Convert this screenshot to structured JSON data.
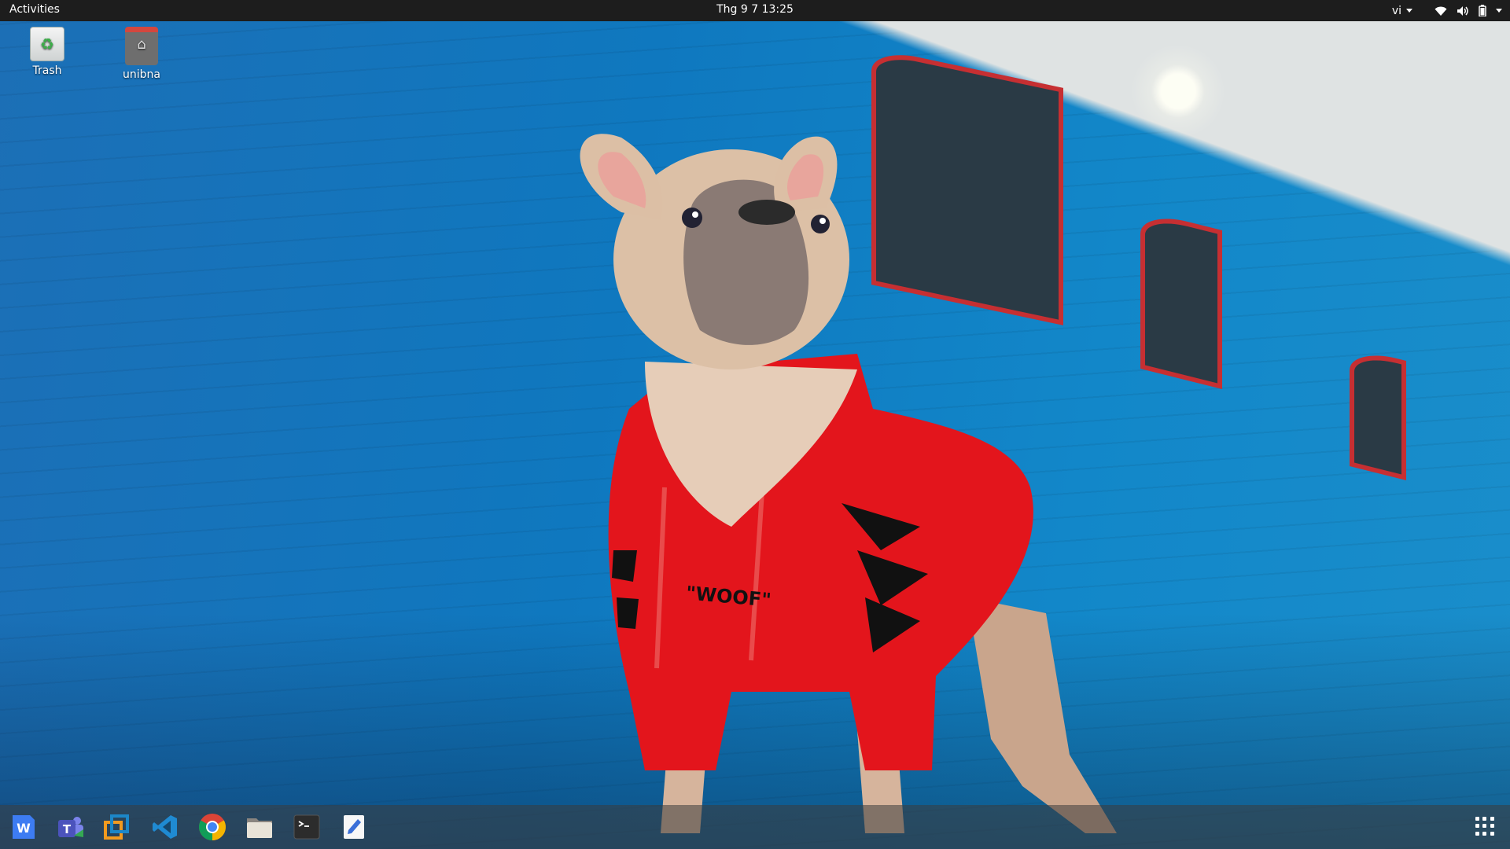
{
  "topbar": {
    "activities": "Activities",
    "clock": "Thg 9 7  13:25",
    "input_method": "vi",
    "icons": [
      "wifi-icon",
      "volume-icon",
      "battery-icon",
      "system-menu-caret-icon"
    ]
  },
  "desktop": {
    "icons": [
      {
        "label": "Trash",
        "icon": "trash-icon"
      },
      {
        "label": "unibna",
        "icon": "home-folder-icon"
      }
    ]
  },
  "wallpaper": {
    "hoodie_text": "\"WOOF\""
  },
  "dock": {
    "apps": [
      {
        "name": "WPS Writer",
        "icon": "wps-writer-icon"
      },
      {
        "name": "Microsoft Teams",
        "icon": "teams-icon"
      },
      {
        "name": "VMware",
        "icon": "vmware-icon"
      },
      {
        "name": "Visual Studio Code",
        "icon": "vscode-icon"
      },
      {
        "name": "Google Chrome",
        "icon": "chrome-icon"
      },
      {
        "name": "Files",
        "icon": "files-icon"
      },
      {
        "name": "Terminal",
        "icon": "terminal-icon"
      },
      {
        "name": "Text Editor",
        "icon": "text-editor-icon"
      }
    ],
    "show_apps_icon": "show-applications-icon"
  },
  "colors": {
    "topbar": "#1d1d1d",
    "wall_blue": "#0f78bf",
    "hoodie_red": "#e3151c"
  }
}
